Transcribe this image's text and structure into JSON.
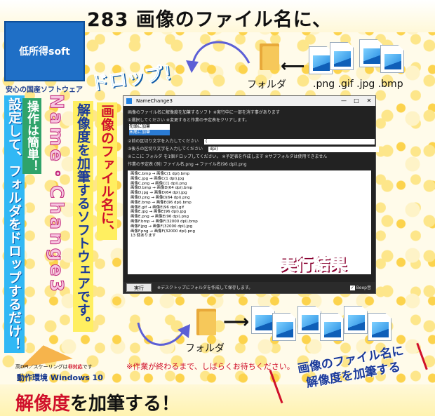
{
  "header": {
    "title": "283 画像のファイル名に、"
  },
  "logo": {
    "text": "低所得soft",
    "subtitle": "安心の国産ソフトウェア"
  },
  "drop_label": "ドロップ！",
  "top_flow": {
    "folder_label": "フォルダ",
    "extensions": ".png .gif .jpg .bmp"
  },
  "vertical": {
    "setup": "設定して、フォルダをドロップするだけ！",
    "ops": "操作は簡単！",
    "name": "Name・Change3",
    "jitter": "解像度を加筆するソフトウェアです。",
    "main": "画像のファイル名に、"
  },
  "window": {
    "title": "NameChange3",
    "controls": [
      "—",
      "□",
      "✕"
    ],
    "desc": "画像のファイル名に解像度を加筆するソフト ※実行中に一部を消す事があります",
    "step1": "①選択してください ※変更すると作業の予定表をクリアします。",
    "options": [
      "先頭に加筆",
      "末尾に加筆"
    ],
    "step2": "②前の区切り文字を入力してください",
    "step2_value": "(",
    "step3": "③後ろの区切り文字を入力してください",
    "step3_value": "dpi)",
    "step4": "④ここに フォルダ を1個ドロップしてください。 ※予定表を作成します ※サブフォルダは使用できません",
    "schedule_header": "作業の予定表 (例) ファイル名.png → ファイル名(96 dpi).png",
    "results": [
      "画像C.bmp → 画像C(1 dpi).bmp",
      "画像C.jpg → 画像C(1 dpi).jpg",
      "画像C.png → 画像C(1 dpi).png",
      "画像D.bmp → 画像D(64 dpi).bmp",
      "画像D.jpg → 画像D(64 dpi).jpg",
      "画像D.png → 画像D(64 dpi).png",
      "画像E.bmp → 画像E(96 dpi).bmp",
      "画像E.gif → 画像E(96 dpi).gif",
      "画像E.jpg → 画像E(96 dpi).jpg",
      "画像E.png → 画像E(96 dpi).png",
      "画像F.bmp → 画像F(32000 dpi).bmp",
      "画像F.jpg → 画像F(32000 dpi).jpg",
      "画像F.png → 画像F(32000 dpi).png",
      " 13 個あります"
    ],
    "run_button": "実行",
    "footer_note": "※デスクトップにフォルダを作成して保存します。",
    "beep_label": "Beep音"
  },
  "result_tag": "実行結果",
  "bottom_flow": {
    "folder_label": "フォルダ"
  },
  "notes": {
    "dpi_prefix": "高DPI／スケーリングは",
    "dpi_red": "非対応",
    "dpi_suffix": "です",
    "env": "動作環境 Windows 10",
    "wait": "※作業が終わるまで、しばらくお待ちください。"
  },
  "footer": {
    "red": "解像度",
    "rest": "を加筆する！"
  },
  "banner": {
    "line1": "画像のファイル名に",
    "line2": "解像度を加筆する"
  },
  "colors": {
    "accent_blue": "#1f6fc6",
    "accent_red": "#d0102a",
    "accent_pink": "#ff3b6f",
    "accent_yellow": "#ffef60"
  }
}
